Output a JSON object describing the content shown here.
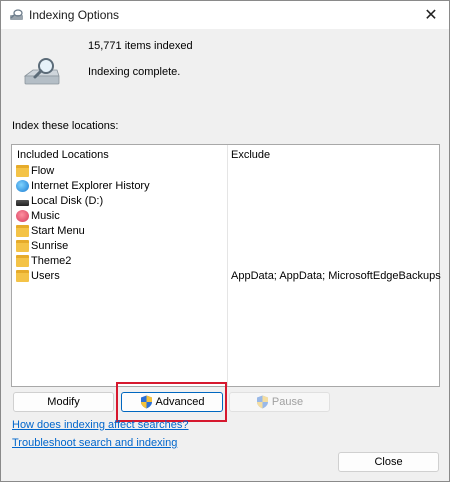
{
  "window": {
    "title": "Indexing Options",
    "close_glyph": "✕"
  },
  "summary": {
    "items_indexed": "15,771 items indexed",
    "status": "Indexing complete."
  },
  "locations": {
    "label": "Index these locations:",
    "headers": {
      "included": "Included Locations",
      "exclude": "Exclude"
    },
    "rows": [
      {
        "name": "Flow",
        "icon": "folder-icon",
        "exclude": ""
      },
      {
        "name": "Internet Explorer History",
        "icon": "internet-explorer-icon",
        "exclude": ""
      },
      {
        "name": "Local Disk (D:)",
        "icon": "disk-drive-icon",
        "exclude": ""
      },
      {
        "name": "Music",
        "icon": "music-icon",
        "exclude": ""
      },
      {
        "name": "Start Menu",
        "icon": "folder-icon",
        "exclude": ""
      },
      {
        "name": "Sunrise",
        "icon": "folder-icon",
        "exclude": ""
      },
      {
        "name": "Theme2",
        "icon": "folder-icon",
        "exclude": ""
      },
      {
        "name": "Users",
        "icon": "folder-icon",
        "exclude": "AppData; AppData; MicrosoftEdgeBackups"
      }
    ]
  },
  "buttons": {
    "modify": "Modify",
    "advanced": "Advanced",
    "pause": "Pause",
    "close": "Close"
  },
  "links": {
    "how_indexing": "How does indexing affect searches?",
    "troubleshoot": "Troubleshoot search and indexing"
  },
  "colors": {
    "highlight": "#d6182e",
    "link": "#0066cc",
    "accent": "#0067c0"
  }
}
